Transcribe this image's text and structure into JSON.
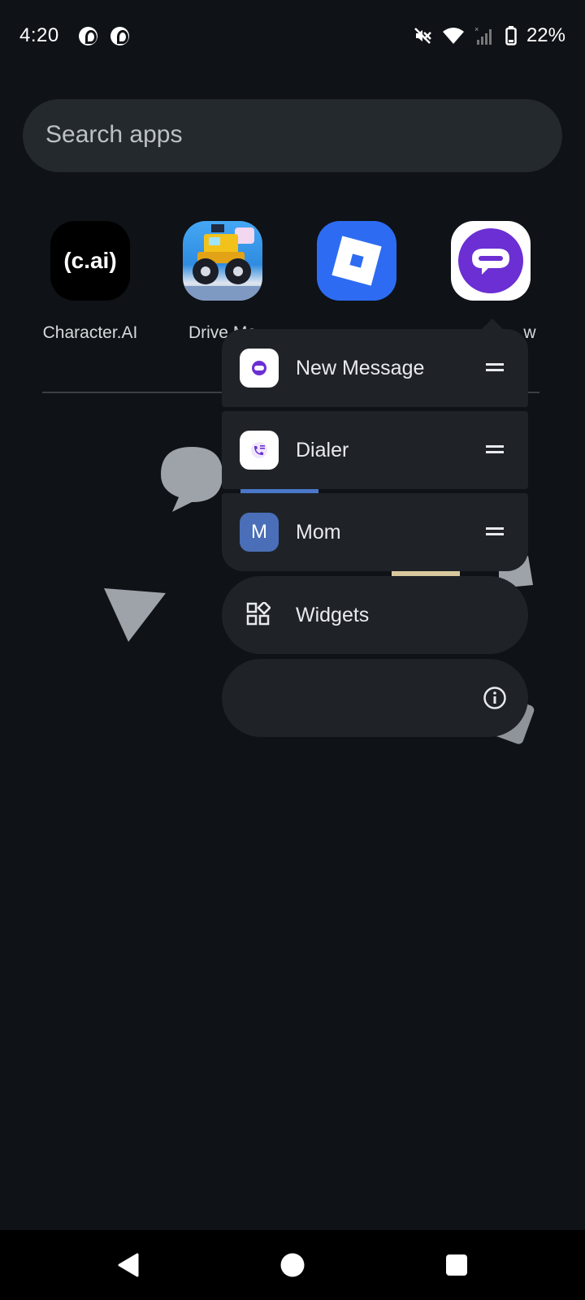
{
  "status_bar": {
    "time": "4:20",
    "notification_icons": [
      "pinterest-icon",
      "pinterest-icon"
    ],
    "system_icons": [
      "vibrate-off-icon",
      "wifi-icon",
      "signal-no-service-icon",
      "battery-icon"
    ],
    "battery": "22%"
  },
  "search": {
    "placeholder": "Search apps"
  },
  "apps": [
    {
      "label": "Character.AI",
      "icon_text": "(c.ai)",
      "icon": "character-ai-icon"
    },
    {
      "label": "Drive Ma",
      "icon": "drive-mad-icon"
    },
    {
      "label": "",
      "icon": "roblox-icon"
    },
    {
      "label": "w",
      "icon": "textnow-icon"
    }
  ],
  "popup_menu": {
    "shortcuts": [
      {
        "label": "New Message",
        "icon": "new-message-icon",
        "draggable": true
      },
      {
        "label": "Dialer",
        "icon": "dialer-icon",
        "draggable": true
      },
      {
        "label": "Mom",
        "icon_text": "M",
        "icon": "contact-avatar",
        "draggable": true
      }
    ],
    "widgets_label": "Widgets",
    "app_info_icon": "info-icon"
  },
  "colors": {
    "background": "#0f1216",
    "search_bg": "#24292e",
    "menu_bg": "#1f2328",
    "textnow_purple": "#6b2fd3",
    "roblox_blue": "#2d6cf2",
    "contact_blue": "#4a6fb8"
  },
  "nav_bar": {
    "buttons": [
      "back-icon",
      "home-icon",
      "recents-icon"
    ]
  }
}
